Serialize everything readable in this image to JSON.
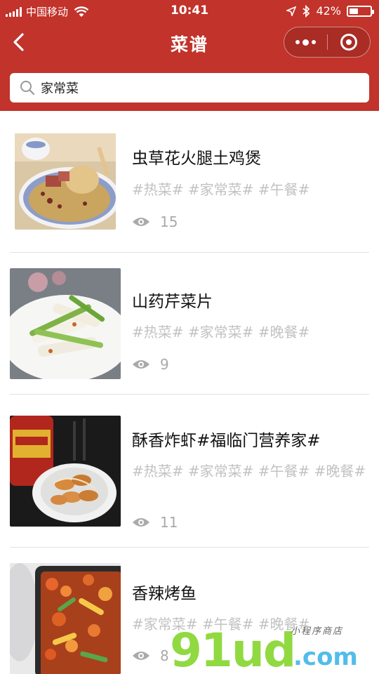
{
  "status_bar": {
    "carrier": "中国移动",
    "time": "10:41",
    "battery_text": "42%",
    "battery_level": 0.42
  },
  "nav": {
    "title": "菜谱"
  },
  "search": {
    "value": "家常菜"
  },
  "colors": {
    "brand": "#c1332b",
    "tag_text": "#c2c2c2",
    "views_text": "#aaaaaa"
  },
  "recipes": [
    {
      "title": "虫草花火腿土鸡煲",
      "tags": "#热菜# #家常菜# #午餐#",
      "views": "15",
      "image_icon": "chicken-soup-pot"
    },
    {
      "title": "山药芹菜片",
      "tags": "#热菜# #家常菜# #晚餐#",
      "views": "9",
      "image_icon": "yam-celery-plate"
    },
    {
      "title": "酥香炸虾#福临门营养家#",
      "tags": "#热菜# #家常菜# #午餐# #晚餐#",
      "views": "11",
      "image_icon": "fried-shrimp-plate"
    },
    {
      "title": "香辣烤鱼",
      "tags": "#家常菜# #午餐# #晚餐#",
      "views": "8",
      "image_icon": "grilled-fish-tray"
    }
  ],
  "watermark": {
    "main": "91ud",
    "suffix": ".com",
    "tagline": "小程序商店"
  }
}
